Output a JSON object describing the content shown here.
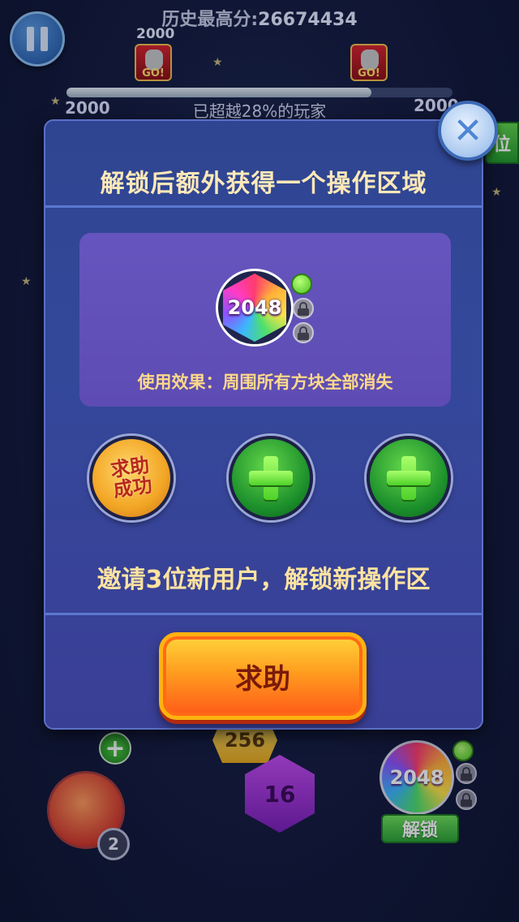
{
  "hud": {
    "best_score_label": "历史最高分:",
    "best_score_value": "26674434",
    "badge_left_score": "2000",
    "progress_left": "2000",
    "progress_right": "2000",
    "progress_percent": 0.79,
    "surpassed_text": "已超越28%的玩家",
    "side_button_label": "位"
  },
  "modal": {
    "title": "解锁后额外获得一个操作区域",
    "item_value": "2048",
    "effect_text": "使用效果：周围所有方块全部消失",
    "slot_done_label_line1": "求助",
    "slot_done_label_line2": "成功",
    "invite_text": "邀请3位新用户，解锁新操作区",
    "help_button_label": "求助",
    "close_symbol": "✕"
  },
  "board": {
    "tile_a_value": "256",
    "tile_b_value": "16",
    "right_gem_value": "2048",
    "unlock_button_label": "解锁",
    "gem_count": "2"
  },
  "colors": {
    "modal_bg": "#34489a",
    "card_bg": "#6655be",
    "title_text": "#ffe9b8",
    "help_button": "#ff9d1f",
    "add_slot": "#1b8e2b"
  },
  "icons": [
    "pause-icon",
    "close-icon",
    "lock-icon",
    "plus-icon",
    "hero-badge-icon"
  ]
}
